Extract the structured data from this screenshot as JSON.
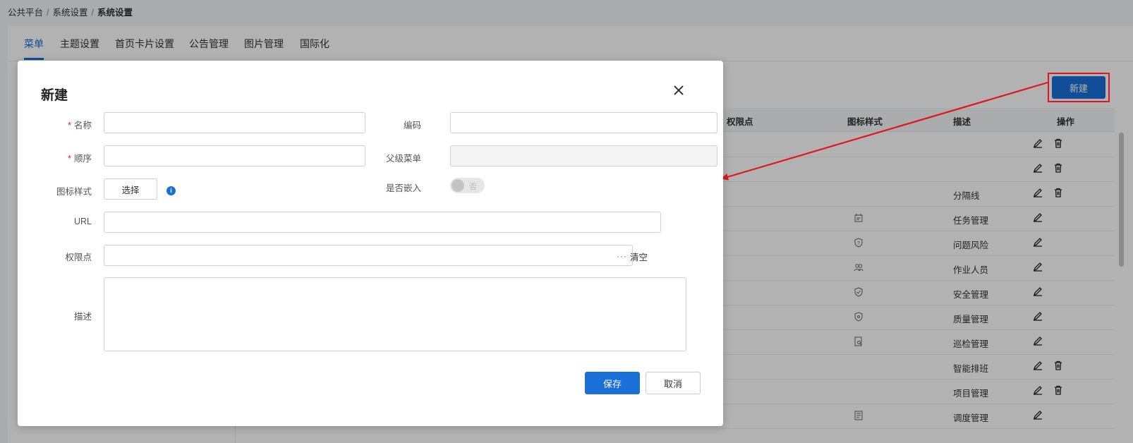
{
  "breadcrumb": {
    "items": [
      "公共平台",
      "系统设置"
    ],
    "current": "系统设置",
    "separator": "/"
  },
  "tabs": [
    {
      "label": "菜单",
      "active": true
    },
    {
      "label": "主题设置"
    },
    {
      "label": "首页卡片设置"
    },
    {
      "label": "公告管理"
    },
    {
      "label": "图片管理"
    },
    {
      "label": "国际化"
    }
  ],
  "toolbar": {
    "new_label": "新建"
  },
  "table": {
    "columns": [
      "权限点",
      "图标样式",
      "描述",
      "操作"
    ],
    "rows": [
      {
        "desc": "",
        "icon": "",
        "actions": [
          "edit",
          "delete"
        ]
      },
      {
        "desc": "",
        "icon": "",
        "actions": [
          "edit",
          "delete"
        ]
      },
      {
        "desc": "分隔线",
        "icon": "",
        "actions": [
          "edit",
          "delete"
        ]
      },
      {
        "desc": "任务管理",
        "icon": "calendar-icon",
        "actions": [
          "edit"
        ]
      },
      {
        "desc": "问题风险",
        "icon": "question-shield-icon",
        "actions": [
          "edit"
        ]
      },
      {
        "desc": "作业人员",
        "icon": "users-icon",
        "actions": [
          "edit"
        ]
      },
      {
        "desc": "安全管理",
        "icon": "check-shield-icon",
        "actions": [
          "edit"
        ]
      },
      {
        "desc": "质量管理",
        "icon": "shield-icon",
        "actions": [
          "edit"
        ]
      },
      {
        "desc": "巡检管理",
        "icon": "doc-search-icon",
        "actions": [
          "edit"
        ]
      },
      {
        "desc": "智能排班",
        "icon": "",
        "actions": [
          "edit",
          "delete"
        ]
      },
      {
        "desc": "项目管理",
        "icon": "",
        "actions": [
          "edit",
          "delete"
        ]
      },
      {
        "desc": "调度管理",
        "icon": "document-icon",
        "actions": [
          "edit"
        ]
      }
    ]
  },
  "modal": {
    "title": "新建",
    "fields": {
      "name": {
        "label": "名称",
        "required": true,
        "value": ""
      },
      "code": {
        "label": "编码",
        "value": ""
      },
      "order": {
        "label": "顺序",
        "required": true,
        "value": ""
      },
      "parent": {
        "label": "父级菜单",
        "value": ""
      },
      "icon_style": {
        "label": "图标样式",
        "button": "选择",
        "info": "i"
      },
      "embed": {
        "label": "是否嵌入",
        "toggle_text": "否",
        "on": false
      },
      "url": {
        "label": "URL",
        "value": ""
      },
      "permission": {
        "label": "权限点",
        "value": "",
        "more": "···",
        "clear": "清空"
      },
      "desc": {
        "label": "描述",
        "value": ""
      }
    },
    "buttons": {
      "save": "保存",
      "cancel": "取消"
    }
  },
  "colors": {
    "accent": "#1a6fd8",
    "highlight": "#e0161e"
  }
}
